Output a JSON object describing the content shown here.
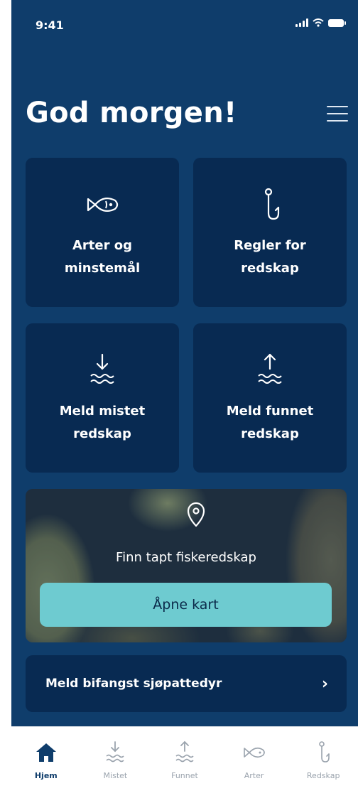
{
  "status_bar": {
    "time": "9:41"
  },
  "header": {
    "greeting": "God morgen!"
  },
  "tiles": [
    {
      "label": "Arter og minstemål",
      "icon": "fish-icon"
    },
    {
      "label": "Regler for redskap",
      "icon": "hook-icon"
    },
    {
      "label": "Meld mistet redskap",
      "icon": "lost-gear-icon"
    },
    {
      "label": "Meld funnet redskap",
      "icon": "found-gear-icon"
    }
  ],
  "map_card": {
    "caption": "Finn tapt fiskeredskap",
    "button_label": "Åpne kart",
    "icon": "location-pin-icon"
  },
  "report_row": {
    "label": "Meld bifangst sjøpattedyr",
    "chevron": "›"
  },
  "tabbar": {
    "active": "Hjem",
    "tabs": [
      {
        "label": "Hjem",
        "icon": "home-icon"
      },
      {
        "label": "Mistet",
        "icon": "lost-gear-icon"
      },
      {
        "label": "Funnet",
        "icon": "found-gear-icon"
      },
      {
        "label": "Arter",
        "icon": "fish-icon"
      },
      {
        "label": "Redskap",
        "icon": "hook-icon"
      }
    ]
  },
  "colors": {
    "background": "#0f3d6b",
    "tile": "#082a52",
    "accent_button": "#6ecbd0",
    "tab_active": "#0f3d6b",
    "tab_inactive": "#9aa3ad"
  }
}
